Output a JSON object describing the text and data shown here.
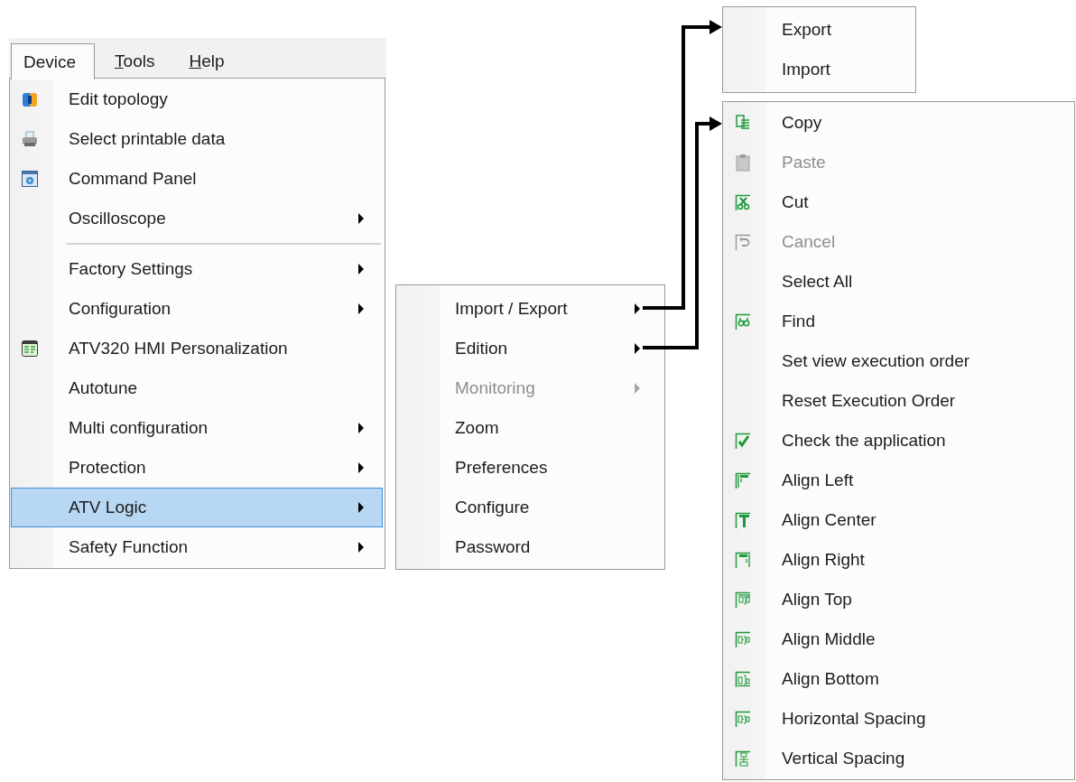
{
  "menu_bar": {
    "tabs": [
      {
        "label": "Device",
        "selected": true,
        "mnemonic": false
      },
      {
        "label": "Tools",
        "selected": false,
        "mnemonic": true
      },
      {
        "label": "Help",
        "selected": false,
        "mnemonic": true
      }
    ]
  },
  "device_menu": {
    "items": [
      {
        "kind": "item",
        "label": "Edit topology",
        "submenu": false,
        "disabled": false,
        "selected": false
      },
      {
        "kind": "item",
        "label": "Select printable data",
        "submenu": false,
        "disabled": false,
        "selected": false
      },
      {
        "kind": "item",
        "label": "Command Panel",
        "submenu": false,
        "disabled": false,
        "selected": false
      },
      {
        "kind": "item",
        "label": "Oscilloscope",
        "submenu": true,
        "disabled": false,
        "selected": false
      },
      {
        "kind": "separator"
      },
      {
        "kind": "item",
        "label": "Factory Settings",
        "submenu": true,
        "disabled": false,
        "selected": false
      },
      {
        "kind": "item",
        "label": "Configuration",
        "submenu": true,
        "disabled": false,
        "selected": false
      },
      {
        "kind": "item",
        "label": "ATV320 HMI Personalization",
        "submenu": false,
        "disabled": false,
        "selected": false
      },
      {
        "kind": "item",
        "label": "Autotune",
        "submenu": false,
        "disabled": false,
        "selected": false
      },
      {
        "kind": "item",
        "label": "Multi configuration",
        "submenu": true,
        "disabled": false,
        "selected": false
      },
      {
        "kind": "item",
        "label": "Protection",
        "submenu": true,
        "disabled": false,
        "selected": false
      },
      {
        "kind": "item",
        "label": "ATV Logic",
        "submenu": true,
        "disabled": false,
        "selected": true
      },
      {
        "kind": "item",
        "label": "Safety Function",
        "submenu": true,
        "disabled": false,
        "selected": false
      }
    ]
  },
  "atv_logic_menu": {
    "items": [
      {
        "kind": "item",
        "label": "Import / Export",
        "submenu": true,
        "disabled": false
      },
      {
        "kind": "item",
        "label": "Edition",
        "submenu": true,
        "disabled": false
      },
      {
        "kind": "item",
        "label": "Monitoring",
        "submenu": true,
        "disabled": true
      },
      {
        "kind": "item",
        "label": "Zoom",
        "submenu": false,
        "disabled": false
      },
      {
        "kind": "item",
        "label": "Preferences",
        "submenu": false,
        "disabled": false
      },
      {
        "kind": "item",
        "label": "Configure",
        "submenu": false,
        "disabled": false
      },
      {
        "kind": "item",
        "label": "Password",
        "submenu": false,
        "disabled": false
      }
    ]
  },
  "import_export_menu": {
    "items": [
      {
        "kind": "item",
        "label": "Export",
        "submenu": false,
        "disabled": false
      },
      {
        "kind": "item",
        "label": "Import",
        "submenu": false,
        "disabled": false
      }
    ]
  },
  "edition_menu": {
    "items": [
      {
        "kind": "item",
        "label": "Copy",
        "submenu": false,
        "disabled": false
      },
      {
        "kind": "item",
        "label": "Paste",
        "submenu": false,
        "disabled": true
      },
      {
        "kind": "item",
        "label": "Cut",
        "submenu": false,
        "disabled": false
      },
      {
        "kind": "item",
        "label": "Cancel",
        "submenu": false,
        "disabled": true
      },
      {
        "kind": "item",
        "label": "Select All",
        "submenu": false,
        "disabled": false
      },
      {
        "kind": "item",
        "label": "Find",
        "submenu": false,
        "disabled": false
      },
      {
        "kind": "item",
        "label": "Set view execution order",
        "submenu": false,
        "disabled": false
      },
      {
        "kind": "item",
        "label": "Reset Execution Order",
        "submenu": false,
        "disabled": false
      },
      {
        "kind": "item",
        "label": "Check the application",
        "submenu": false,
        "disabled": false
      },
      {
        "kind": "item",
        "label": "Align Left",
        "submenu": false,
        "disabled": false
      },
      {
        "kind": "item",
        "label": "Align Center",
        "submenu": false,
        "disabled": false
      },
      {
        "kind": "item",
        "label": "Align Right",
        "submenu": false,
        "disabled": false
      },
      {
        "kind": "item",
        "label": "Align Top",
        "submenu": false,
        "disabled": false
      },
      {
        "kind": "item",
        "label": "Align Middle",
        "submenu": false,
        "disabled": false
      },
      {
        "kind": "item",
        "label": "Align Bottom",
        "submenu": false,
        "disabled": false
      },
      {
        "kind": "item",
        "label": "Horizontal Spacing",
        "submenu": false,
        "disabled": false
      },
      {
        "kind": "item",
        "label": "Vertical Spacing",
        "submenu": false,
        "disabled": false
      }
    ]
  }
}
